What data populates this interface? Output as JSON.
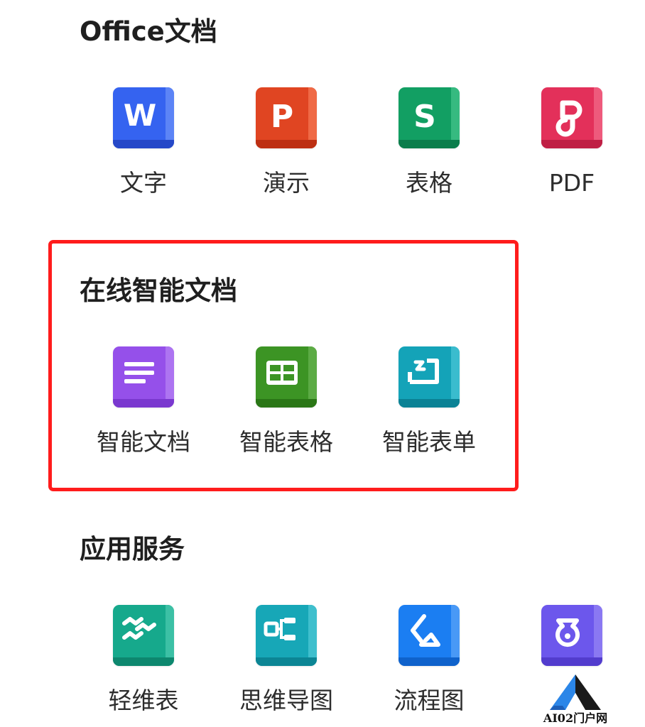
{
  "sections": {
    "office": {
      "title": "Office文档",
      "items": [
        {
          "label": "文字",
          "icon": "word-doc-icon",
          "color": "#3563f0"
        },
        {
          "label": "演示",
          "icon": "presentation-icon",
          "color": "#e04522"
        },
        {
          "label": "表格",
          "icon": "spreadsheet-icon",
          "color": "#129f63"
        },
        {
          "label": "PDF",
          "icon": "pdf-icon",
          "color": "#e3305a"
        }
      ]
    },
    "smart": {
      "title": "在线智能文档",
      "items": [
        {
          "label": "智能文档",
          "icon": "smart-doc-icon",
          "color": "#9550ea"
        },
        {
          "label": "智能表格",
          "icon": "smart-table-icon",
          "color": "#3c9424"
        },
        {
          "label": "智能表单",
          "icon": "smart-form-icon",
          "color": "#14a3b8"
        }
      ]
    },
    "apps": {
      "title": "应用服务",
      "items": [
        {
          "label": "轻维表",
          "icon": "light-table-icon",
          "color": "#16a98c"
        },
        {
          "label": "思维导图",
          "icon": "mind-map-icon",
          "color": "#17a7b7"
        },
        {
          "label": "流程图",
          "icon": "flowchart-icon",
          "color": "#1b7ef2"
        },
        {
          "label": "",
          "icon": "app-service-icon",
          "color": "#6c57ec"
        }
      ]
    }
  },
  "highlight_color": "#ff1c1c",
  "watermark": {
    "text": "AI02门户网"
  }
}
